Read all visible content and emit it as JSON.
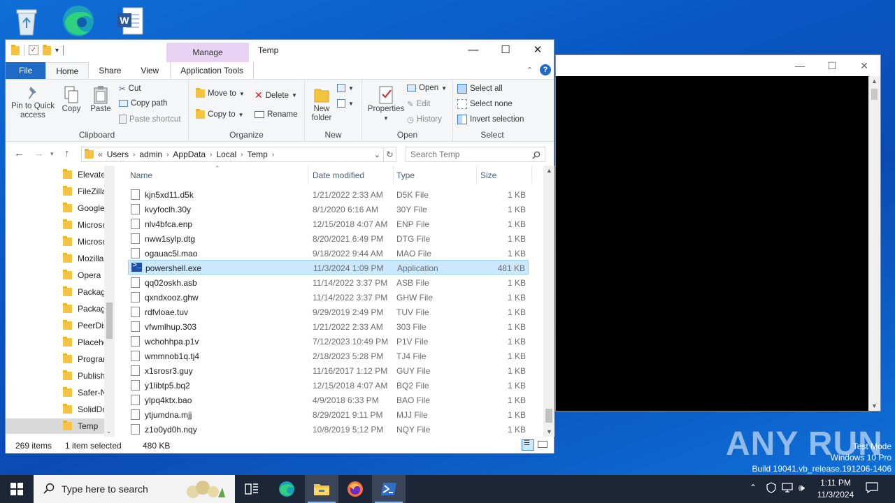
{
  "window": {
    "title": "Temp",
    "manage_tab": "Manage",
    "tabs": [
      "File",
      "Home",
      "Share",
      "View",
      "Application Tools"
    ]
  },
  "ribbon": {
    "clipboard": {
      "pin": "Pin to Quick access",
      "copy": "Copy",
      "paste": "Paste",
      "cut": "Cut",
      "copy_path": "Copy path",
      "paste_shortcut": "Paste shortcut",
      "label": "Clipboard"
    },
    "organize": {
      "move_to": "Move to",
      "copy_to": "Copy to",
      "delete": "Delete",
      "rename": "Rename",
      "label": "Organize"
    },
    "new": {
      "new_folder": "New folder",
      "label": "New"
    },
    "open": {
      "properties": "Properties",
      "open": "Open",
      "edit": "Edit",
      "history": "History",
      "label": "Open"
    },
    "select": {
      "select_all": "Select all",
      "select_none": "Select none",
      "invert": "Invert selection",
      "label": "Select"
    }
  },
  "address": {
    "prefix": "«",
    "crumbs": [
      "Users",
      "admin",
      "AppData",
      "Local",
      "Temp"
    ],
    "search_placeholder": "Search Temp"
  },
  "nav": {
    "items": [
      "Elevate",
      "FileZilla",
      "Google",
      "Microso",
      "Microso",
      "Mozilla",
      "Opera",
      "Packag",
      "Packag",
      "PeerDis",
      "Placeho",
      "Prograr",
      "Publish",
      "Safer-N",
      "SolidDo",
      "Temp"
    ],
    "selected": "Temp"
  },
  "columns": {
    "name": "Name",
    "date": "Date modified",
    "type": "Type",
    "size": "Size"
  },
  "files": [
    {
      "name": "kjn5xd11.d5k",
      "date": "1/21/2022 2:33 AM",
      "type": "D5K File",
      "size": "1 KB"
    },
    {
      "name": "kvyfoclh.30y",
      "date": "8/1/2020 6:16 AM",
      "type": "30Y File",
      "size": "1 KB"
    },
    {
      "name": "nlv4bfca.enp",
      "date": "12/15/2018 4:07 AM",
      "type": "ENP File",
      "size": "1 KB"
    },
    {
      "name": "nww1sylp.dtg",
      "date": "8/20/2021 6:49 PM",
      "type": "DTG File",
      "size": "1 KB"
    },
    {
      "name": "ogauac5l.mao",
      "date": "9/18/2022 9:44 AM",
      "type": "MAO File",
      "size": "1 KB"
    },
    {
      "name": "powershell.exe",
      "date": "11/3/2024 1:09 PM",
      "type": "Application",
      "size": "481 KB"
    },
    {
      "name": "qq02oskh.asb",
      "date": "11/14/2022 3:37 PM",
      "type": "ASB File",
      "size": "1 KB"
    },
    {
      "name": "qxndxooz.ghw",
      "date": "11/14/2022 3:37 PM",
      "type": "GHW File",
      "size": "1 KB"
    },
    {
      "name": "rdfvloae.tuv",
      "date": "9/29/2019 2:49 PM",
      "type": "TUV File",
      "size": "1 KB"
    },
    {
      "name": "vfwmlhup.303",
      "date": "1/21/2022 2:33 AM",
      "type": "303 File",
      "size": "1 KB"
    },
    {
      "name": "wchohhpa.p1v",
      "date": "7/12/2023 10:49 PM",
      "type": "P1V File",
      "size": "1 KB"
    },
    {
      "name": "wmmnob1q.tj4",
      "date": "2/18/2023 5:28 PM",
      "type": "TJ4 File",
      "size": "1 KB"
    },
    {
      "name": "x1srosr3.guy",
      "date": "11/16/2017 1:12 PM",
      "type": "GUY File",
      "size": "1 KB"
    },
    {
      "name": "y1libtp5.bq2",
      "date": "12/15/2018 4:07 AM",
      "type": "BQ2 File",
      "size": "1 KB"
    },
    {
      "name": "ylpq4ktx.bao",
      "date": "4/9/2018 6:33 PM",
      "type": "BAO File",
      "size": "1 KB"
    },
    {
      "name": "ytjumdna.mjj",
      "date": "8/29/2021 9:11 PM",
      "type": "MJJ File",
      "size": "1 KB"
    },
    {
      "name": "z1o0yd0h.nqy",
      "date": "10/8/2019 5:12 PM",
      "type": "NQY File",
      "size": "1 KB"
    }
  ],
  "status": {
    "count": "269 items",
    "selected": "1 item selected",
    "selected_size": "480 KB"
  },
  "taskbar": {
    "search_placeholder": "Type here to search",
    "time": "1:11 PM",
    "date": "11/3/2024"
  },
  "watermark": {
    "line1": "Test Mode",
    "line2": "Windows 10 Pro",
    "line3": "Build 19041.vb_release.191206-1406",
    "brand": "ANY RUN"
  },
  "colors": {
    "accent": "#1f6ac6",
    "selection": "#cce8ff",
    "manage": "#e9d3f4",
    "taskbar": "#1c2636"
  }
}
